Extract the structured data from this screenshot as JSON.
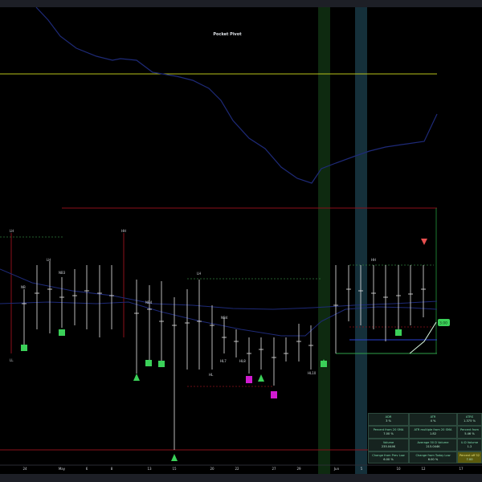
{
  "chart": {
    "title": "Pocket Pivot",
    "x_labels": [
      "24",
      "May",
      "6",
      "8",
      "13",
      "15",
      "20",
      "22",
      "27",
      "29",
      "Jun",
      "5",
      "10",
      "12",
      "17"
    ],
    "annotations": {
      "lh": "LH",
      "hh": "HH",
      "ll": "LL",
      "hl": "HL",
      "nb": "NB",
      "nb3": "NB3",
      "nb4": "NB4",
      "hl7": "HL7",
      "hl8": "HL8",
      "hl10": "HL10"
    },
    "price_tag": "3.00",
    "colors": {
      "background": "#000000",
      "price_line": "#1e2a78",
      "yellow_level": "#b8c21a",
      "red_level": "#8b0f1a",
      "green_highlight": "#0e2a10",
      "blue_highlight": "#15303a",
      "pivot_green": "#3bd159",
      "pivot_magenta": "#d11bd1",
      "down_arrow": "#e85050"
    }
  },
  "stats": [
    {
      "label": "ADR",
      "value": "3 %"
    },
    {
      "label": "ATR",
      "value": "4 %"
    },
    {
      "label": "ATRS",
      "value": "1.375 %"
    },
    {
      "label": "Percent from 20 SMA",
      "value": "7.00 %"
    },
    {
      "label": "ATR multiple from 20 SMA",
      "value": "1.82"
    },
    {
      "label": "Percent from",
      "value": "5.46 %"
    },
    {
      "label": "Volume",
      "value": "235.044K"
    },
    {
      "label": "Average 50 D Volume",
      "value": "215.044K"
    },
    {
      "label": "U-D Volume",
      "value": "1.2"
    },
    {
      "label": "Change from Prev Low",
      "value": "6.00 %"
    },
    {
      "label": "Change from Today Low",
      "value": "6.00 %"
    },
    {
      "label": "Percent off 52",
      "value": "7.00"
    }
  ]
}
